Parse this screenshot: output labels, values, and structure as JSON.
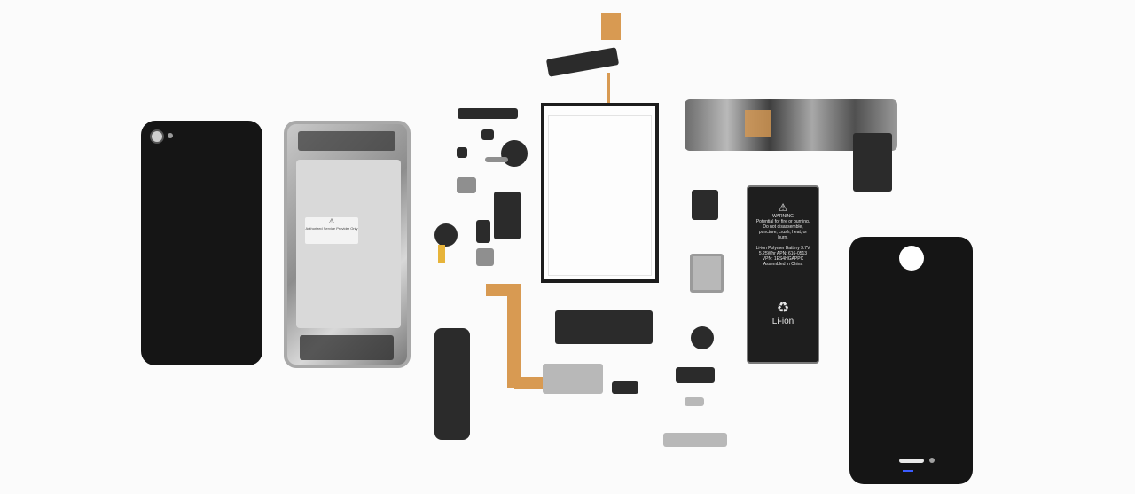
{
  "battery": {
    "warning_label": "WARNING",
    "warning_text": "Potential for fire or burning. Do not disassemble, puncture, crush, heat, or burn.",
    "spec_text": "Li-ion Polymer Battery 3.7V 5.25Whr APN: 616-0513 VPN: 1ES4HGAPPC Assembled in China",
    "chem_label": "Li-ion"
  },
  "frame_sticker": {
    "text": "Authorized Service Provider Only"
  },
  "colors": {
    "background": "#fbfbfb",
    "glass_black": "#151515",
    "flex_cable": "#d89a52"
  }
}
